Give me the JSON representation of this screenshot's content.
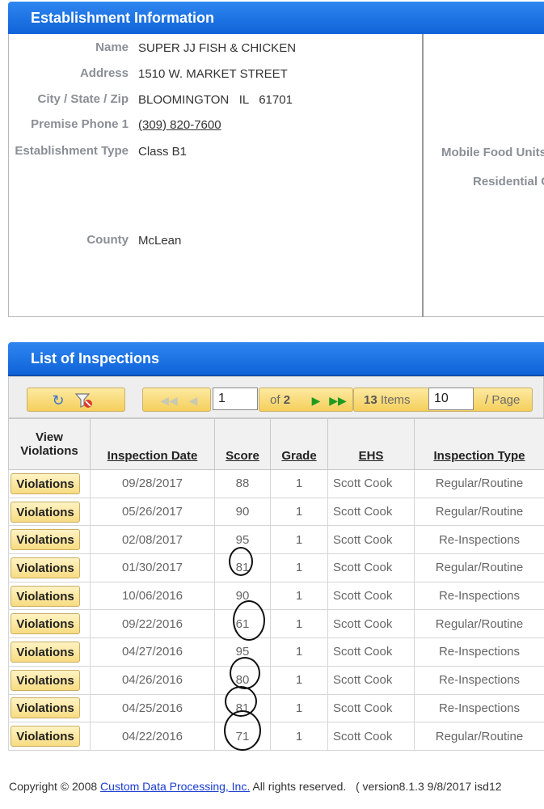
{
  "establishment": {
    "title": "Establishment Information",
    "fields": [
      {
        "label": "Name",
        "value": "SUPER JJ FISH & CHICKEN"
      },
      {
        "label": "Address",
        "value": "1510 W. MARKET STREET"
      },
      {
        "label": "City / State / Zip",
        "value": "BLOOMINGTON   IL   61701"
      },
      {
        "label": "Premise Phone 1",
        "value": "(309) 820-7600"
      },
      {
        "label": "Establishment Type",
        "value": "Class B1"
      },
      {
        "label": "County",
        "value": "McLean"
      }
    ],
    "right_labels": [
      "Mobile Food Units",
      "Residential C"
    ]
  },
  "inspections": {
    "title": "List of Inspections",
    "pager": {
      "page": "1",
      "of_label": "of",
      "total_pages": "2",
      "items_count": "13",
      "items_label": "Items",
      "page_size": "10",
      "page_size_label": "/ Page"
    },
    "columns": [
      "View Violations",
      "Inspection Date",
      "Score",
      "Grade",
      "EHS",
      "Inspection Type"
    ],
    "button_label": "Violations",
    "rows": [
      {
        "date": "09/28/2017",
        "score": "88",
        "grade": "1",
        "ehs": "Scott Cook",
        "type": "Regular/Routine"
      },
      {
        "date": "05/26/2017",
        "score": "90",
        "grade": "1",
        "ehs": "Scott Cook",
        "type": "Regular/Routine"
      },
      {
        "date": "02/08/2017",
        "score": "95",
        "grade": "1",
        "ehs": "Scott Cook",
        "type": "Re-Inspections"
      },
      {
        "date": "01/30/2017",
        "score": "81",
        "grade": "1",
        "ehs": "Scott Cook",
        "type": "Regular/Routine"
      },
      {
        "date": "10/06/2016",
        "score": "90",
        "grade": "1",
        "ehs": "Scott Cook",
        "type": "Re-Inspections"
      },
      {
        "date": "09/22/2016",
        "score": "61",
        "grade": "1",
        "ehs": "Scott Cook",
        "type": "Regular/Routine"
      },
      {
        "date": "04/27/2016",
        "score": "95",
        "grade": "1",
        "ehs": "Scott Cook",
        "type": "Re-Inspections"
      },
      {
        "date": "04/26/2016",
        "score": "80",
        "grade": "1",
        "ehs": "Scott Cook",
        "type": "Re-Inspections"
      },
      {
        "date": "04/25/2016",
        "score": "81",
        "grade": "1",
        "ehs": "Scott Cook",
        "type": "Re-Inspections"
      },
      {
        "date": "04/22/2016",
        "score": "71",
        "grade": "1",
        "ehs": "Scott Cook",
        "type": "Regular/Routine"
      }
    ]
  },
  "footer": {
    "prefix": "Copyright © 2008",
    "link": "Custom Data Processing, Inc.",
    "suffix": "All rights reserved.   ( version8.1.3 9/8/2017 isd12"
  },
  "colors": {
    "header_blue": "#1a6fe6",
    "button_gold": "#f5cf5c"
  },
  "icons": [
    "refresh-icon",
    "clear-filter-icon",
    "first-page-icon",
    "prev-page-icon",
    "next-page-icon",
    "last-page-icon"
  ]
}
